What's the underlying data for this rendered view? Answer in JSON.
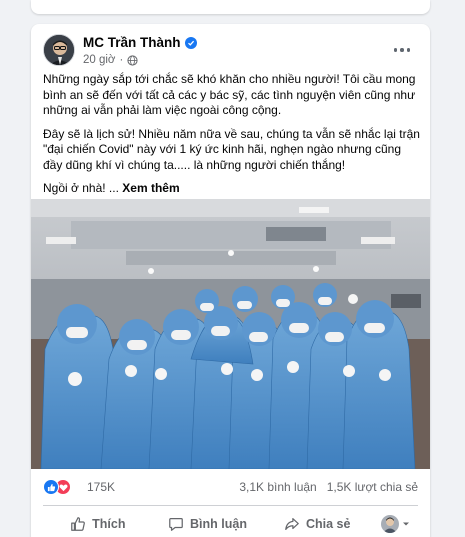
{
  "post": {
    "author": "MC Trần Thành",
    "time": "20 giờ",
    "paragraphs": [
      "Những ngày sắp tới chắc sẽ khó khăn cho nhiều người! Tôi cầu mong bình an sẽ đến với tất cả các y bác sỹ, các tình nguyện viên cũng như những ai vẫn phải làm việc ngoài công cộng.",
      "Đây sẽ là lịch sử! Nhiều năm nữa về sau, chúng ta vẫn sẽ nhắc lại trận \"đại chiến Covid\" này với 1 ký ức kinh hãi, nghẹn ngào nhưng cũng đầy dũng khí vì chúng ta..... là những người chiến thắng!"
    ],
    "last_line": "Ngồi ở nhà! ...",
    "see_more": "Xem thêm"
  },
  "stats": {
    "reactions": "175K",
    "comments": "3,1K bình luận",
    "shares": "1,5K lượt chia sẻ"
  },
  "actions": {
    "like": "Thích",
    "comment": "Bình luận",
    "share": "Chia sẻ"
  },
  "icons": {
    "verified": "verified-badge-icon",
    "audience": "globe-icon",
    "more": "more-options-icon",
    "like_reaction": "thumbs-up-icon",
    "love_reaction": "heart-icon"
  },
  "colors": {
    "accent": "#1877f2",
    "love": "#f33e58",
    "secondary_text": "#65676b"
  }
}
